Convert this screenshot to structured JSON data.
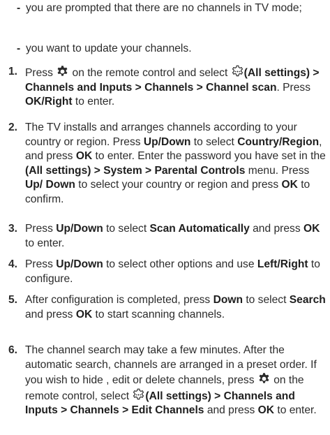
{
  "bullets": [
    {
      "marker": "-",
      "text": "you are prompted that there are no channels in TV mode;"
    },
    {
      "marker": "-",
      "text": "you want to update your channels."
    }
  ],
  "steps": [
    {
      "num": "1.",
      "parts": {
        "a": "Press ",
        "b": " on the remote control and select ",
        "c": "(All settings) > Channels and Inputs > Channels > Channel scan",
        "d": ". Press ",
        "e": "OK/Right",
        "f": " to enter."
      }
    },
    {
      "num": "2.",
      "parts": {
        "a": "The TV installs and arranges channels according to your country or region. Press ",
        "b": "Up/Down",
        "c": " to select ",
        "d": "Country/Region",
        "e": ", and press ",
        "f": "OK",
        "g": " to enter. Enter the password you have set in the ",
        "h": "(All settings) > System > Parental Controls",
        "i": " menu. Press ",
        "j": "Up/ Down",
        "k": " to select your country or region and press ",
        "l": "OK",
        "m": " to confirm."
      }
    },
    {
      "num": "3.",
      "parts": {
        "a": "Press ",
        "b": "Up/Down",
        "c": " to select ",
        "d": "Scan Automatically",
        "e": " and press ",
        "f": "OK",
        "g": " to enter."
      }
    },
    {
      "num": "4.",
      "parts": {
        "a": "Press ",
        "b": "Up/Down",
        "c": " to select other options and use ",
        "d": "Left/Right",
        "e": " to configure."
      }
    },
    {
      "num": "5.",
      "parts": {
        "a": "After configuration is completed, press ",
        "b": "Down",
        "c": " to select ",
        "d": "Search",
        "e": " and press ",
        "f": "OK",
        "g": " to start scanning channels."
      }
    },
    {
      "num": "6.",
      "parts": {
        "a": "The channel search may take a few minutes. After the automatic search, channels are arranged in a preset order. If you wish to hide , edit or delete channels, press ",
        "b": " on the remote control, select ",
        "c": "(All settings) > Channels and Inputs > Channels > Edit Channels",
        "d": " and press ",
        "e": "OK",
        "f": " to enter."
      }
    }
  ],
  "icons": {
    "settings": "settings-gear-icon",
    "all_settings": "all-settings-icon"
  }
}
